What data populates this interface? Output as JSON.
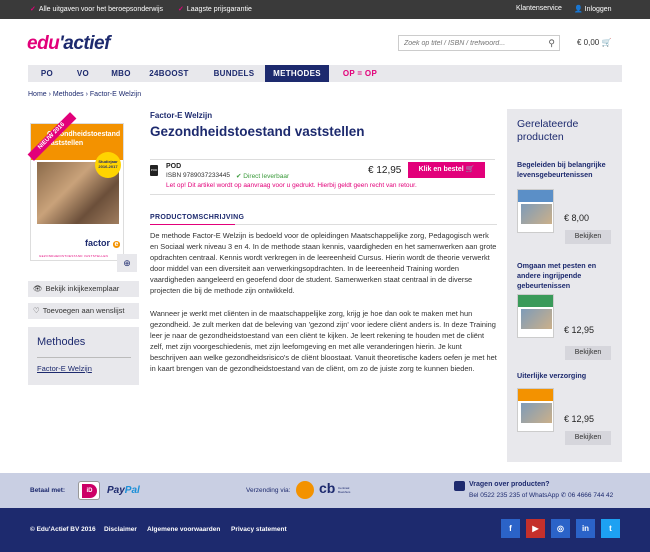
{
  "topbar": {
    "usp1": "Alle uitgaven voor het beroepsonderwijs",
    "usp2": "Laagste prijsgarantie",
    "service": "Klantenservice",
    "login": "Inloggen"
  },
  "header": {
    "logo_a": "edu",
    "logo_b": "'actief",
    "search_placeholder": "Zoek op titel / ISBN / trefwoord...",
    "cart_total": "€ 0,00"
  },
  "nav": [
    "PO",
    "VO",
    "MBO",
    "24BOOST",
    "BUNDELS",
    "METHODES",
    "OP = OP"
  ],
  "breadcrumb": [
    "Home",
    "Methodes",
    "Factor-E Welzijn"
  ],
  "cover": {
    "ribbon": "NIEUW 2016",
    "title": "Gezondheidstoestand vaststellen",
    "sticker": "Studiejaar 2016-2017",
    "brand": "factor",
    "brand_e": "e",
    "sub": "GEZONDHEIDSTOESTAND VASTSTELLEN"
  },
  "left": {
    "inkijk": "Bekijk inkijkexemplaar",
    "wishlist": "Toevoegen aan wenslijst",
    "methods_heading": "Methodes",
    "methods_link": "Factor-E Welzijn"
  },
  "product": {
    "series": "Factor-E Welzijn",
    "title": "Gezondheidstoestand vaststellen",
    "pod_icon": "POD",
    "format": "POD",
    "isbn": "ISBN 9789037233445",
    "availability": "Direct leverbaar",
    "price": "€ 12,95",
    "buy_label": "Klik en bestel",
    "note": "Let op! Dit artikel wordt op aanvraag voor u gedrukt. Hierbij geldt geen recht van retour.",
    "desc_heading": "PRODUCTOMSCHRIJVING",
    "para1": "De methode Factor-E Welzijn is bedoeld voor de opleidingen Maatschappelijke zorg, Pedagogisch werk en Sociaal werk niveau 3 en 4. In de methode staan kennis, vaardigheden en het samenwerken aan grote opdrachten centraal. Kennis wordt verkregen in de leereenheid Cursus. Hierin wordt de theorie verwerkt door middel van een diversiteit aan verwerkingsopdrachten. In de leereenheid Training worden vaardigheden aangeleerd en geoefend door de student. Samenwerken staat centraal in de diverse projecten die bij de methode zijn ontwikkeld.",
    "para2": "Wanneer je werkt met cliënten in de maatschappelijke zorg, krijg je hoe dan ook te maken met hun gezondheid. Je zult merken dat de beleving van 'gezond zijn' voor iedere cliënt anders is. In deze Training leer je naar de gezondheidstoestand van een cliënt te kijken. Je leert rekening te houden met de cliënt zelf, met zijn voorgeschiedenis, met zijn leefomgeving en met alle veranderingen hierin. Je kunt beschrijven aan welke gezondheidsrisico's de cliënt bloostaat. Vanuit theoretische kaders oefen je met het in kaart brengen van de gezondheidstoestand van de cliënt, om zo de juiste zorg te kunnen bieden."
  },
  "related": {
    "heading": "Gerelateerde producten",
    "items": [
      {
        "title": "Begeleiden bij belangrijke levensgebeurtenissen",
        "price": "€ 8,00",
        "button": "Bekijken",
        "color": "#5b8fc7"
      },
      {
        "title": "Omgaan met pesten en andere ingrijpende gebeurtenissen",
        "price": "€ 12,95",
        "button": "Bekijken",
        "color": "#3a9a5a"
      },
      {
        "title": "Uiterlijke verzorging",
        "price": "€ 12,95",
        "button": "Bekijken",
        "color": "#f39200"
      }
    ]
  },
  "footer": {
    "pay_label": "Betaal met:",
    "ideal": "iD",
    "paypal_a": "Pay",
    "paypal_b": "Pal",
    "ship_label": "Verzending via:",
    "cb": "cb",
    "cb_sub": "Centraal Boekhuis",
    "questions": "Vragen over producten?",
    "phone": "Bel 0522 235 235 of WhatsApp ✆ 06 4666 744 42",
    "copyright": "© Edu'Actief BV 2016",
    "links": [
      "Disclaimer",
      "Algemene voorwaarden",
      "Privacy statement"
    ],
    "social": [
      "f",
      "▶",
      "◎",
      "in",
      "t"
    ]
  }
}
